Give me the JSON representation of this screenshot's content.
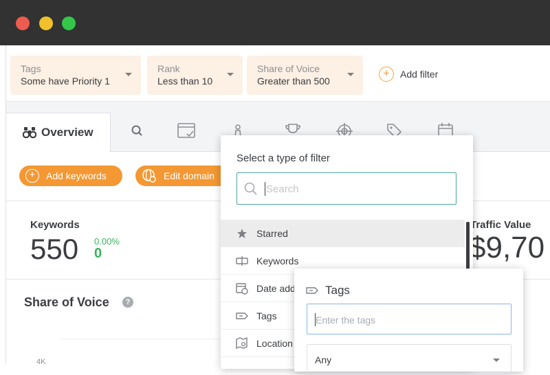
{
  "filters": [
    {
      "label": "Tags",
      "value": "Some have Priority 1"
    },
    {
      "label": "Rank",
      "value": "Less than 10"
    },
    {
      "label": "Share of Voice",
      "value": "Greater than 500"
    }
  ],
  "add_filter_label": "Add filter",
  "tabs": {
    "overview_label": "Overview",
    "icons": [
      "search-icon",
      "browser-check-icon",
      "chess-pawn-icon",
      "trophy-icon",
      "target-icon",
      "tags-icon",
      "calendar-icon"
    ]
  },
  "actions": {
    "add_keywords": "Add keywords",
    "edit_domain": "Edit domain"
  },
  "stats": {
    "keywords_label": "Keywords",
    "keywords_value": "550",
    "keywords_change_pct": "0.00%",
    "keywords_change": "0",
    "traffic_label": "Traffic Value",
    "traffic_value": "$9,70"
  },
  "share_of_voice": {
    "title": "Share of Voice",
    "help": "?",
    "y_tick": "4K"
  },
  "filter_dropdown": {
    "title": "Select a type of filter",
    "search_placeholder": "Search",
    "items": [
      {
        "label": "Starred",
        "icon": "star-icon"
      },
      {
        "label": "Keywords",
        "icon": "keyword-icon"
      },
      {
        "label": "Date added",
        "icon": "calendar-clock-icon"
      },
      {
        "label": "Tags",
        "icon": "tag-icon"
      },
      {
        "label": "Location",
        "icon": "map-search-icon"
      }
    ]
  },
  "tags_panel": {
    "title": "Tags",
    "input_placeholder": "Enter the tags",
    "select_value": "Any"
  },
  "colors": {
    "accent_orange": "#f39833",
    "filter_chip_bg": "#fdf0e4",
    "positive_green": "#34b55a",
    "search_border": "#4aa5a3"
  }
}
